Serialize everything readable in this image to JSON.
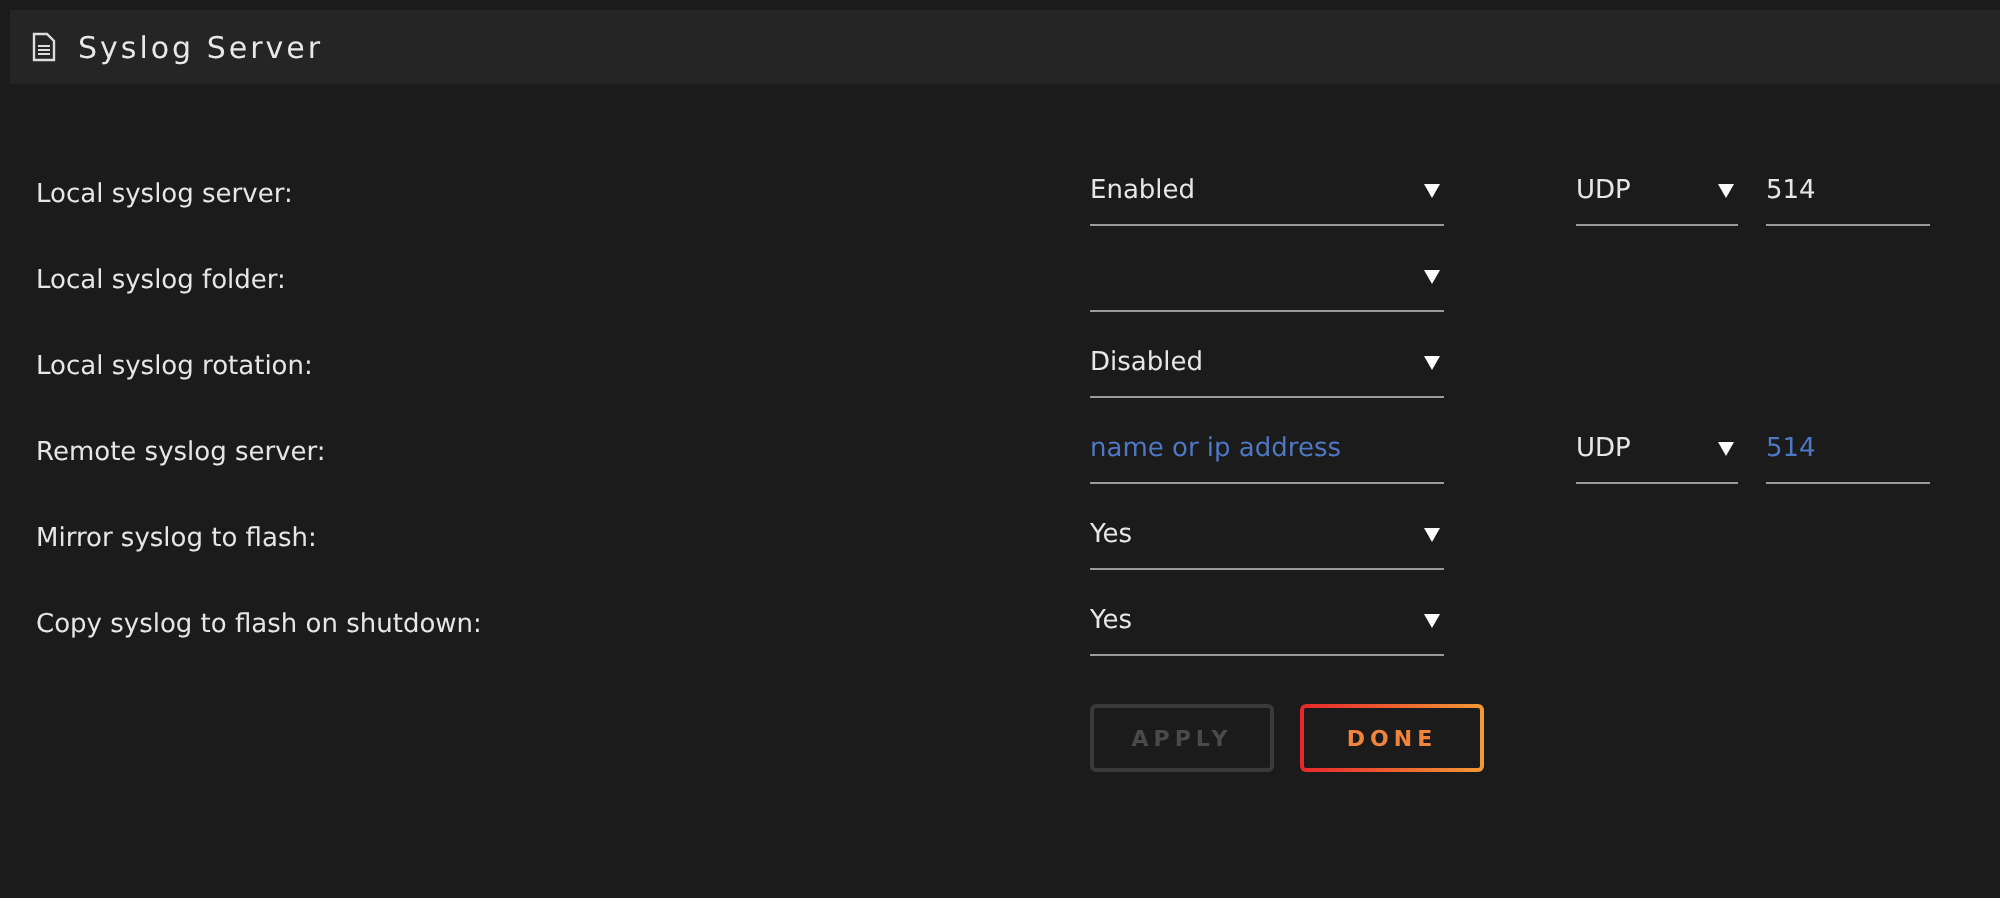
{
  "header": {
    "title": "Syslog Server"
  },
  "rows": [
    {
      "label": "Local syslog server:",
      "fields": [
        {
          "kind": "select",
          "value": "Enabled"
        },
        {
          "kind": "select",
          "value": "UDP"
        },
        {
          "kind": "text",
          "value": "514"
        }
      ]
    },
    {
      "label": "Local syslog folder:",
      "fields": [
        {
          "kind": "select"
        }
      ]
    },
    {
      "label": "Local syslog rotation:",
      "fields": [
        {
          "kind": "select",
          "value": "Disabled"
        }
      ]
    },
    {
      "label": "Remote syslog server:",
      "fields": [
        {
          "kind": "text",
          "placeholder": "name or ip address"
        },
        {
          "kind": "select",
          "value": "UDP"
        },
        {
          "kind": "text",
          "placeholder": "514"
        }
      ]
    },
    {
      "label": "Mirror syslog to flash:",
      "fields": [
        {
          "kind": "select",
          "value": "Yes"
        }
      ]
    },
    {
      "label": "Copy syslog to flash on shutdown:",
      "fields": [
        {
          "kind": "select",
          "value": "Yes"
        }
      ]
    }
  ],
  "buttons": [
    {
      "label": "APPLY",
      "disabled": true
    },
    {
      "label": "DONE",
      "disabled": false
    }
  ]
}
